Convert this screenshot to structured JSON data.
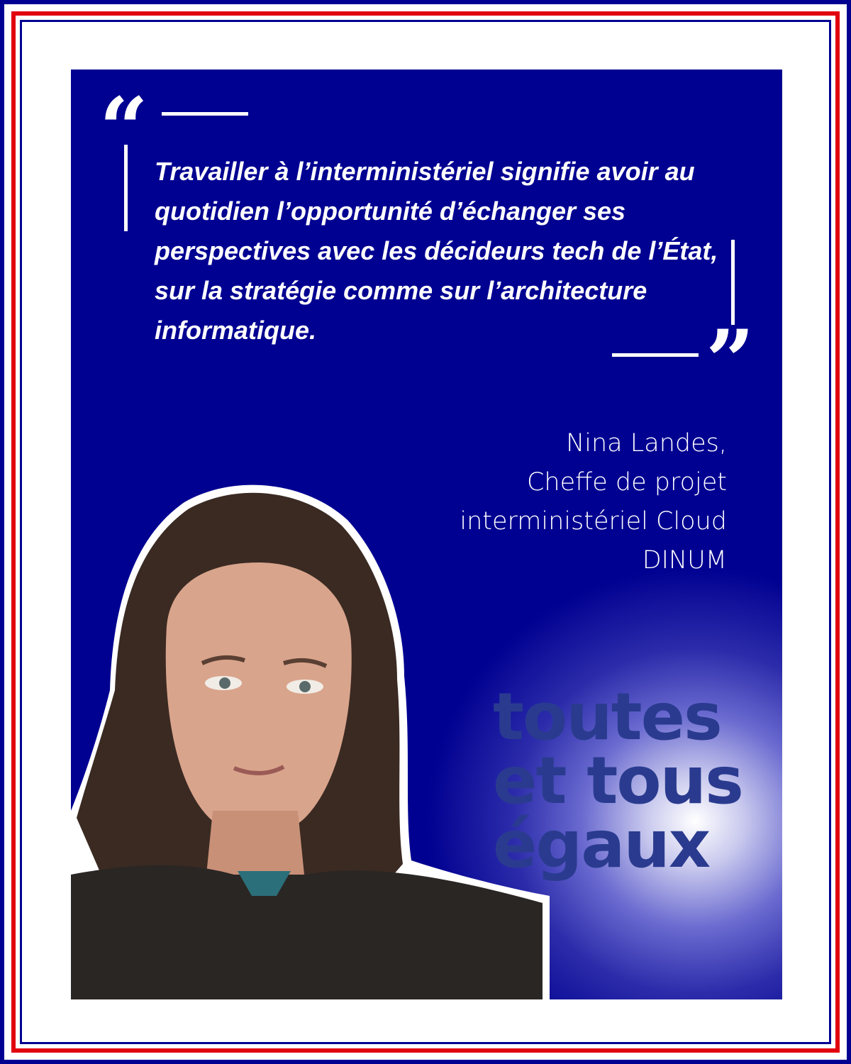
{
  "quote": {
    "open_mark": "“",
    "close_mark": "”",
    "text": "Travailler à l’interministériel signifie avoir au quotidien l’opportunité d’échanger ses perspectives avec les décideurs tech de l’État, sur la stratégie comme sur l’architecture informatique."
  },
  "author": {
    "name": "Nina Landes,",
    "role": "Cheffe de projet",
    "team": "interministériel Cloud",
    "org": "DINUM"
  },
  "logo": {
    "line1": "toutes",
    "line2": "et tous",
    "line3": "égaux"
  },
  "colors": {
    "blue": "#000091",
    "red": "#e1000f",
    "white": "#ffffff"
  }
}
